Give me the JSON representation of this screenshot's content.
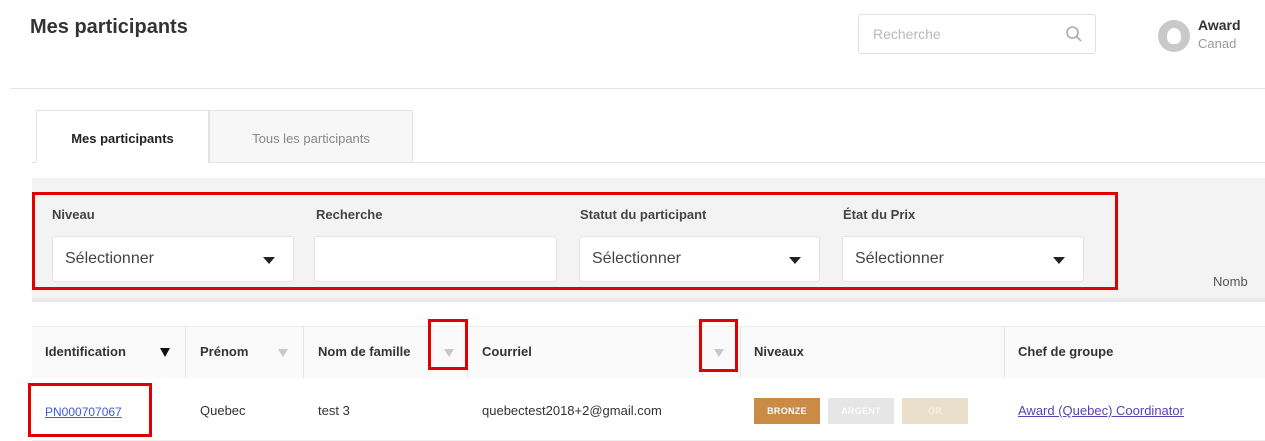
{
  "header": {
    "title": "Mes participants",
    "search_placeholder": "Recherche",
    "user_name": "Award",
    "user_subtitle": "Canad"
  },
  "tabs": [
    {
      "label": "Mes participants",
      "active": true
    },
    {
      "label": "Tous les participants",
      "active": false
    }
  ],
  "filters": {
    "niveau": {
      "label": "Niveau",
      "value": "Sélectionner"
    },
    "recherche": {
      "label": "Recherche",
      "value": ""
    },
    "statut": {
      "label": "Statut du participant",
      "value": "Sélectionner"
    },
    "etat": {
      "label": "État du Prix",
      "value": "Sélectionner"
    },
    "count_label": "Nomb"
  },
  "table": {
    "columns": [
      "Identification",
      "Prénom",
      "Nom de famille",
      "Courriel",
      "Niveaux",
      "Chef de groupe"
    ],
    "rows": [
      {
        "id": "PN000707067",
        "prenom": "Quebec",
        "nom": "test 3",
        "courriel": "quebectest2018+2@gmail.com",
        "niveaux": [
          "BRONZE",
          "ARGENT",
          "OR"
        ],
        "chef": "Award (Quebec) Coordinator"
      }
    ]
  },
  "colors": {
    "highlight": "#e00000",
    "bronze": "#c98b45",
    "link": "#3b5bdb"
  }
}
